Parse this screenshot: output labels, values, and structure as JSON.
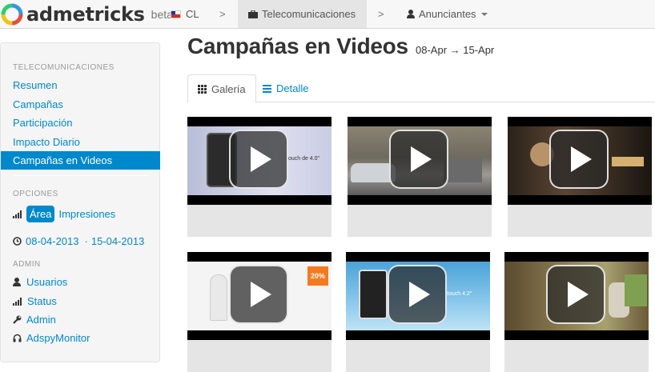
{
  "navbar": {
    "brand": "admetricks",
    "beta": "beta",
    "country": "CL",
    "sep1": ">",
    "category": "Telecomunicaciones",
    "sep2": ">",
    "advertisers": "Anunciantes"
  },
  "sidebar": {
    "section_main": "TELECOMUNICACIONES",
    "items": [
      {
        "label": "Resumen"
      },
      {
        "label": "Campañas"
      },
      {
        "label": "Participación"
      },
      {
        "label": "Impacto Diario"
      },
      {
        "label": "Campañas en Videos"
      }
    ],
    "section_options": "OPCIONES",
    "chart_option_active": "Área",
    "chart_option_other": "Impresiones",
    "date_from": "08-04-2013",
    "date_sep": "·",
    "date_to": "15-04-2013",
    "section_admin": "ADMIN",
    "admin_items": [
      {
        "label": "Usuarios",
        "icon": "user-icon"
      },
      {
        "label": "Status",
        "icon": "signal-icon"
      },
      {
        "label": "Admin",
        "icon": "wrench-icon"
      },
      {
        "label": "AdspyMonitor",
        "icon": "headphones-icon"
      }
    ]
  },
  "main": {
    "title": "Campañas en Videos",
    "range": "08-Apr → 15-Apr",
    "tabs": [
      {
        "label": "Galería"
      },
      {
        "label": "Detalle"
      }
    ],
    "videos": [
      {
        "caption": "touch de 4.0\""
      },
      {
        "caption": ""
      },
      {
        "caption": ""
      },
      {
        "caption": "20%"
      },
      {
        "caption": "touch 4.2\""
      },
      {
        "caption": ""
      }
    ]
  },
  "colors": {
    "link": "#0088cc",
    "active_bg": "#0088cc",
    "navbar_bg": "#f7f7f7",
    "sidebar_bg": "#f5f5f5"
  }
}
